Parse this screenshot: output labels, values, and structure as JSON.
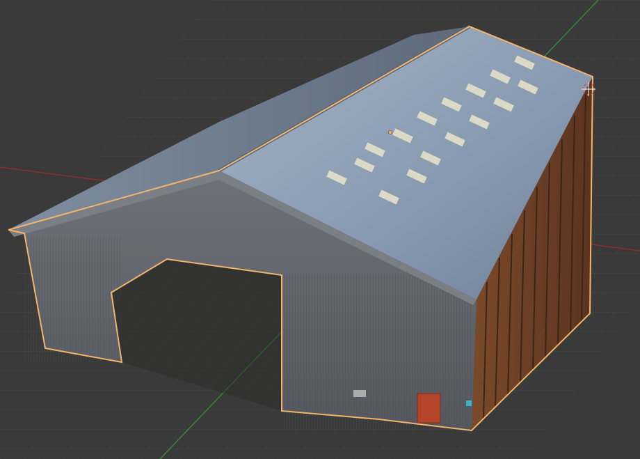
{
  "app": {
    "name": "",
    "view_mode": "",
    "view_label": ""
  },
  "viewport": {
    "background": "#3a3a3a",
    "grid_color": "#2f2f2f",
    "grid_line_color": "#444444",
    "axis_x_color": "#8c2f2f",
    "axis_y_color": "#2f8c2f",
    "selection_outline_color": "#f3b56a",
    "cursor_color": "#d84b4b",
    "object": {
      "name": "",
      "selected": true
    }
  },
  "hud": {
    "line1": "",
    "line2": ""
  }
}
